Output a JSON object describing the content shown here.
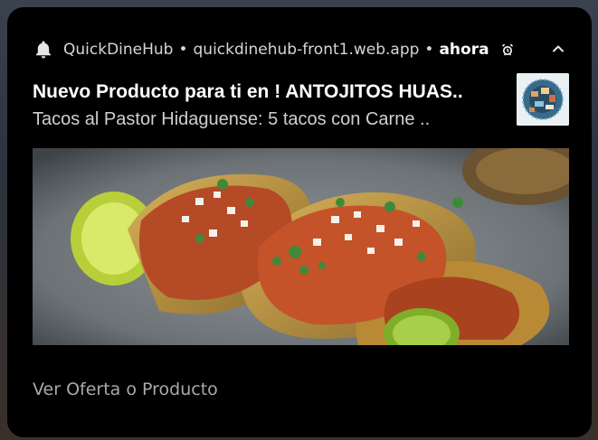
{
  "notification": {
    "app_name": "QuickDineHub",
    "separator": "•",
    "site": "quickdinehub-front1.web.app",
    "time": "ahora",
    "title": "Nuevo Producto para ti en ! ANTOJITOS HUAS..",
    "body": "Tacos al Pastor Hidaguense: 5 tacos con Carne ..",
    "action_label": "Ver Oferta o Producto",
    "icons": {
      "bell": "bell-icon",
      "snooze": "alarm-icon",
      "expand": "chevron-up-icon"
    }
  },
  "colors": {
    "card_bg": "#000000",
    "title": "#ffffff",
    "body": "#cfcfcf",
    "action": "#a9a9a9"
  }
}
